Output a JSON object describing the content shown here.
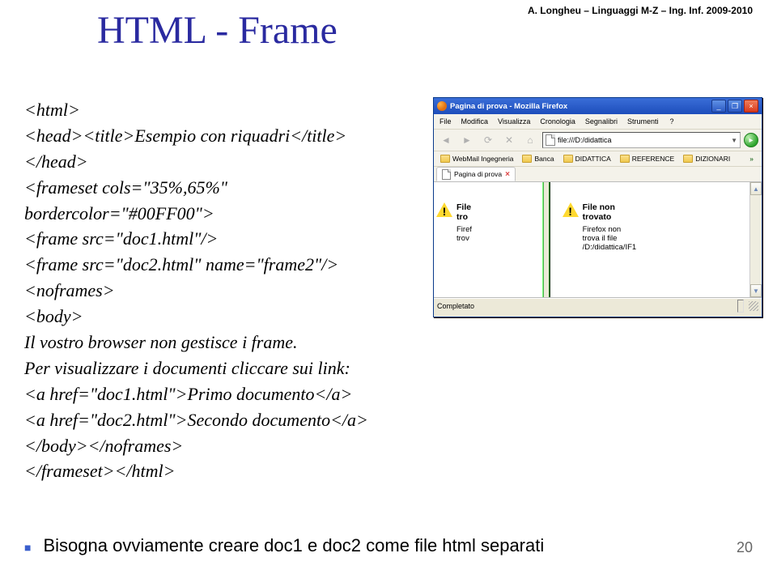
{
  "attrib": "A. Longheu – Linguaggi M-Z – Ing. Inf. 2009-2010",
  "title": "HTML - Frame",
  "code_lines": [
    "<html>",
    "<head><title>Esempio con riquadri</title>",
    "</head>",
    "<frameset cols=\"35%,65%\"",
    "bordercolor=\"#00FF00\">",
    "<frame src=\"doc1.html\"/>",
    "<frame src=\"doc2.html\" name=\"frame2\"/>",
    "<noframes>",
    "<body>",
    "Il vostro browser non gestisce i frame.",
    "Per visualizzare i documenti cliccare sui link:",
    "<a href=\"doc1.html\">Primo documento</a>",
    "<a href=\"doc2.html\">Secondo documento</a>",
    "</body></noframes>",
    "</frameset></html>"
  ],
  "bullet": "Bisogna ovviamente creare doc1 e doc2 come file html separati",
  "page_num": "20",
  "browser": {
    "window_title": "Pagina di prova - Mozilla Firefox",
    "menu": [
      "File",
      "Modifica",
      "Visualizza",
      "Cronologia",
      "Segnalibri",
      "Strumenti",
      "?"
    ],
    "min": "_",
    "max": "❐",
    "close": "×",
    "url": "file:///D:/didattica",
    "bookmarks": [
      "WebMail Ingegneria",
      "Banca",
      "DIDATTICA",
      "REFERENCE",
      "DIZIONARI"
    ],
    "tab_label": "Pagina di prova",
    "frame_left": {
      "heading": "File",
      "sub": "tro",
      "body": "Firef\ntrov",
      "path": ""
    },
    "frame_right": {
      "heading": "File non\ntrovato",
      "body": "Firefox non\ntrova il file\n/D:/didattica/IF1"
    },
    "status": "Completato"
  }
}
